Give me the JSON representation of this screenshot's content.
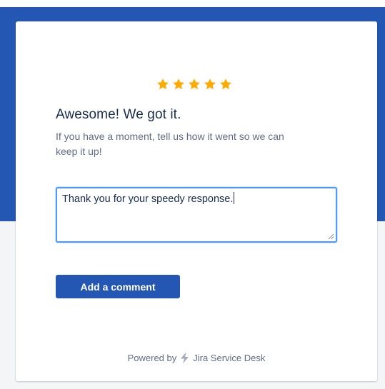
{
  "rating": {
    "stars": 5,
    "max": 5,
    "star_color": "#ffab00"
  },
  "title": "Awesome! We got it.",
  "subtitle": "If you have a moment, tell us how it went so we can keep it up!",
  "comment": {
    "value": "Thank you for your speedy response."
  },
  "add_comment_button": {
    "label": "Add a comment"
  },
  "footer": {
    "powered_by": "Powered by",
    "product_name": "Jira Service Desk",
    "icon": "lightning-bolt-icon"
  },
  "colors": {
    "brand": "#2456b4",
    "text": "#172b4d",
    "muted": "#5e6c84",
    "focus": "#4c9aff"
  }
}
